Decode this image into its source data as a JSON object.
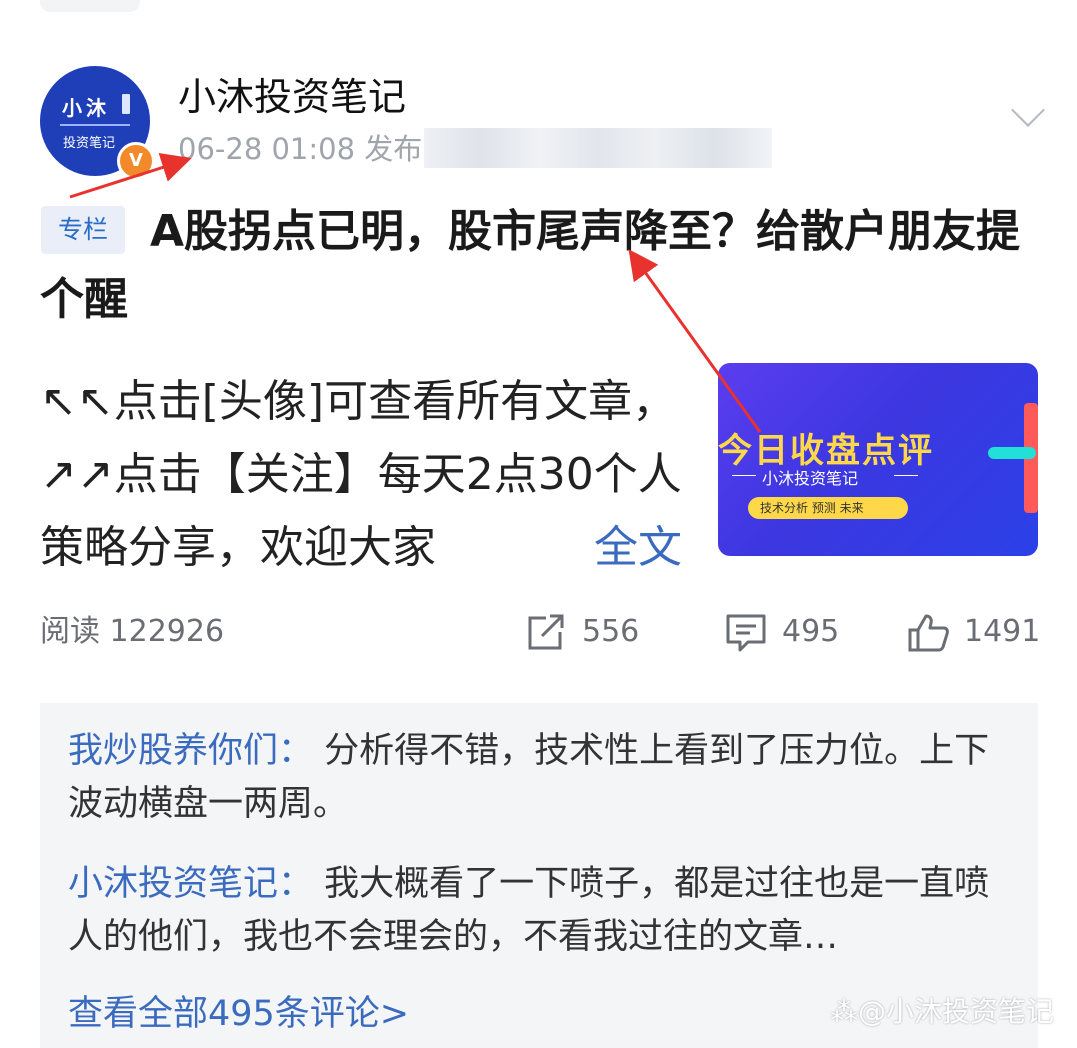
{
  "author": {
    "avatar_line1": "小沐",
    "avatar_line2": "投资笔记",
    "verified_badge": "V",
    "name": "小沐投资笔记",
    "meta": "06-28 01:08  发布"
  },
  "post": {
    "tag": "专栏",
    "title": "A股拐点已明，股市尾声降至？给散户朋友提个醒",
    "excerpt": "↖↖点击[头像]可查看所有文章，↗↗点击【关注】每天2点30个人策略分享，欢迎大家",
    "full_text_link": "全文",
    "thumbnail": {
      "title": "今日收盘点评",
      "subtitle": "小沐投资笔记",
      "pill": "技术分析  预测  未来"
    }
  },
  "stats": {
    "reads": "阅读 122926",
    "shares": "556",
    "comments": "495",
    "likes": "1491"
  },
  "comments": [
    {
      "user": "我炒股养你们：",
      "text": "分析得不错，技术性上看到了压力位。上下波动横盘一两周。"
    },
    {
      "user": "小沐投资笔记：",
      "text": "我大概看了一下喷子，都是过往也是一直喷人的他们，我也不会理会的，不看我过往的文章…"
    }
  ],
  "view_all_comments": "查看全部495条评论>",
  "watermark": "⁂@小沐投资笔记",
  "colors": {
    "link": "#3b6bbf",
    "annotation_arrow": "#e8322e",
    "badge": "#f28a2c"
  }
}
